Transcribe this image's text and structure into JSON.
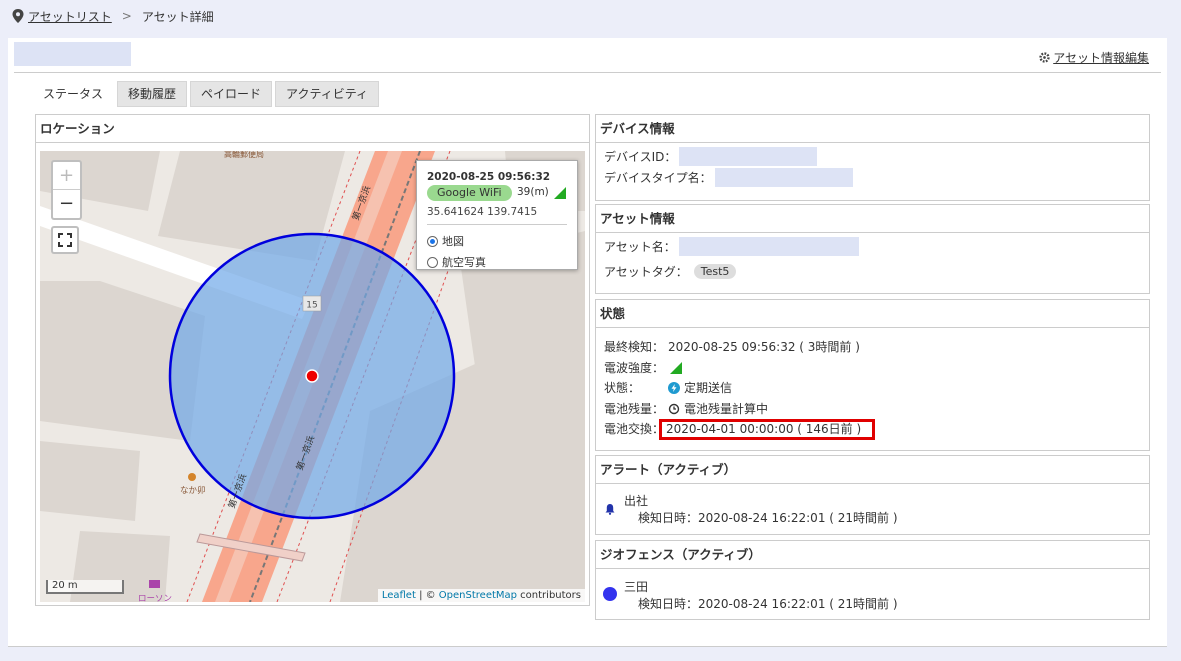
{
  "breadcrumb": {
    "asset_list": "アセットリスト",
    "separator": ">",
    "current": "アセット詳細"
  },
  "header": {
    "edit_link": "アセット情報編集"
  },
  "tabs": [
    "ステータス",
    "移動履歴",
    "ペイロード",
    "アクティビティ"
  ],
  "location": {
    "title": "ロケーション",
    "zoom_in": "+",
    "zoom_out": "−",
    "popup": {
      "timestamp": "2020-08-25 09:56:32",
      "source": "Google WiFi",
      "accuracy": "39(m)",
      "coords": "35.641624 139.7415",
      "option_map": "地図",
      "option_aerial": "航空写真"
    },
    "scale": "20 m",
    "attribution": {
      "leaflet": "Leaflet",
      "sep": " | © ",
      "osm": "OpenStreetMap",
      "contrib": " contributors"
    },
    "map_labels": {
      "road_1": "第一京浜",
      "road_2": "第一京浜",
      "road_3": "第一京浜",
      "route_no": "15",
      "post_office": "高輪郵便局",
      "shop": "なか卯",
      "store": "ローソン"
    }
  },
  "device": {
    "title": "デバイス情報",
    "id_label": "デバイスID：",
    "type_label": "デバイスタイプ名："
  },
  "asset": {
    "title": "アセット情報",
    "name_label": "アセット名：",
    "tag_label": "アセットタグ：",
    "tag": "Test5"
  },
  "state": {
    "title": "状態",
    "last_detect_label": "最終検知：",
    "last_detect_value": "2020-08-25 09:56:32 ( 3時間前 )",
    "signal_label": "電波強度：",
    "status_label": "状態：",
    "status_value": "定期送信",
    "battery_label": "電池残量：",
    "battery_value": "電池残量計算中",
    "battery_change_label": "電池交換：",
    "battery_change_value": "2020-04-01 00:00:00 ( 146日前 )"
  },
  "alert": {
    "title": "アラート（アクティブ）",
    "name": "出社",
    "detail": "検知日時：2020-08-24 16:22:01 ( 21時間前 )"
  },
  "geofence": {
    "title": "ジオフェンス（アクティブ）",
    "name": "三田",
    "detail": "検知日時：2020-08-24 16:22:01 ( 21時間前 )"
  },
  "colors": {
    "accent_red": "#e00000",
    "circle_fill": "#6fa8e8",
    "circle_stroke": "#0000dd",
    "signal_green": "#22aa22",
    "geofence_blue": "#3333ee"
  }
}
